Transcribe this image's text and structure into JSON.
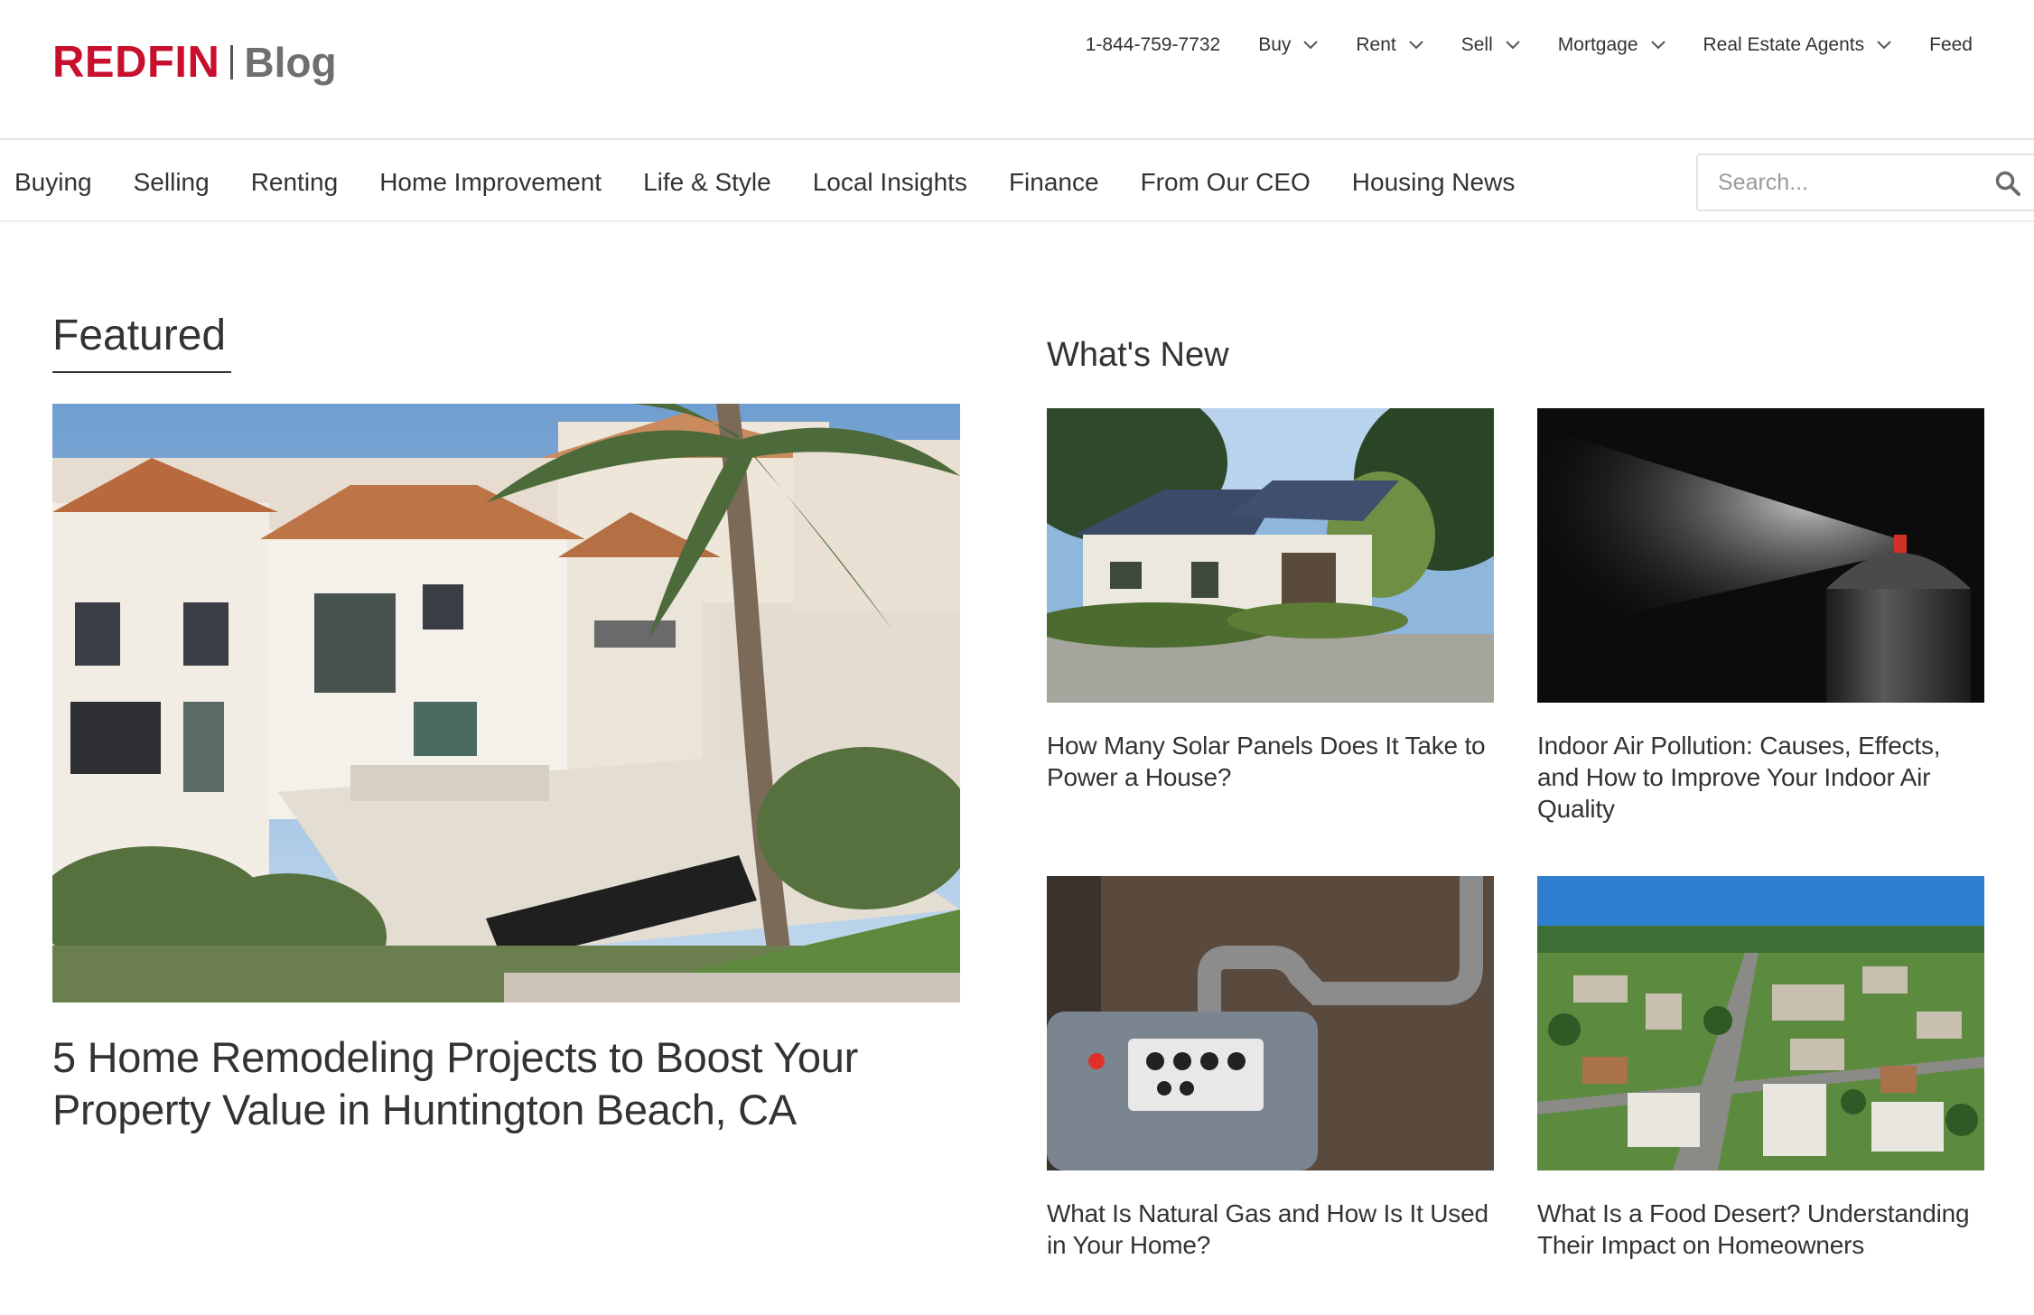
{
  "brand": {
    "logo_name": "REDFIN",
    "logo_suffix": "Blog",
    "brand_color": "#c8102e"
  },
  "top_nav": {
    "phone": "1-844-759-7732",
    "items": [
      {
        "label": "Buy",
        "has_dropdown": true
      },
      {
        "label": "Rent",
        "has_dropdown": true
      },
      {
        "label": "Sell",
        "has_dropdown": true
      },
      {
        "label": "Mortgage",
        "has_dropdown": true
      },
      {
        "label": "Real Estate Agents",
        "has_dropdown": true
      },
      {
        "label": "Feed",
        "has_dropdown": false
      }
    ]
  },
  "categories": [
    "Buying",
    "Selling",
    "Renting",
    "Home Improvement",
    "Life & Style",
    "Local Insights",
    "Finance",
    "From Our CEO",
    "Housing News"
  ],
  "search": {
    "placeholder": "Search...",
    "value": "",
    "icon": "search-icon"
  },
  "featured": {
    "heading": "Featured",
    "title": "5 Home Remodeling Projects to Boost Your Property Value in Huntington Beach, CA"
  },
  "whats_new": {
    "heading": "What's New",
    "articles": [
      {
        "title": "How Many Solar Panels Does It Take to Power a House?"
      },
      {
        "title": "Indoor Air Pollution: Causes, Effects, and How to Improve Your Indoor Air Quality"
      },
      {
        "title": "What Is Natural Gas and How Is It Used in Your Home?"
      },
      {
        "title": "What Is a Food Desert? Understanding Their Impact on Homeowners"
      }
    ]
  }
}
